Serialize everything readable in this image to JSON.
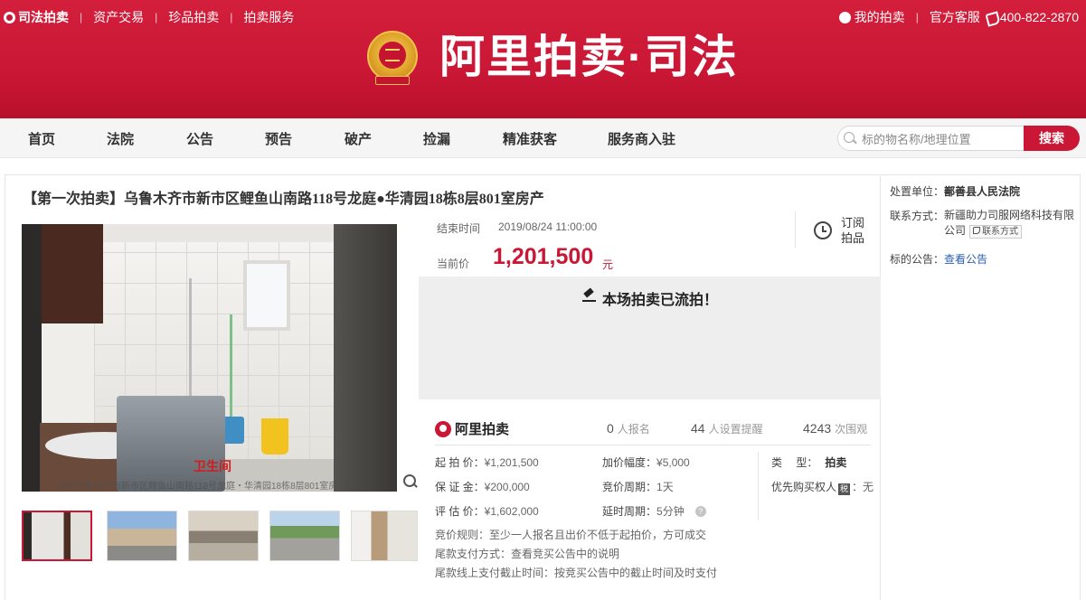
{
  "topbar": {
    "brand": "司法拍卖",
    "links": [
      "资产交易",
      "珍品拍卖",
      "拍卖服务"
    ],
    "my_auction": "我的拍卖",
    "service": "官方客服",
    "phone": "400-822-2870",
    "logo_text": "阿里拍卖·司法"
  },
  "nav": {
    "items": [
      "首页",
      "法院",
      "公告",
      "预告",
      "破产",
      "捡漏",
      "精准获客",
      "服务商入驻"
    ],
    "search_placeholder": "标的物名称/地理位置",
    "search_button": "搜索"
  },
  "item": {
    "title": "【第一次拍卖】乌鲁木齐市新市区鲤鱼山南路118号龙庭●华清园18栋8层801室房产",
    "photo_label": "卫生间",
    "photo_caption": "位于乌鲁木齐市新市区鲤鱼山南路118号龙庭・华清园18栋8层801室房产",
    "end_time_label": "结束时间",
    "end_time": "2019/08/24 11:00:00",
    "price_label": "当前价",
    "price": "1,201,500",
    "price_unit": "元",
    "subscribe": "订阅拍品",
    "status": "本场拍卖已流拍！",
    "platform": "阿里拍卖",
    "stats": {
      "registered_count": "0",
      "registered_label": "人报名",
      "reminder_count": "44",
      "reminder_label": "人设置提醒",
      "views_count": "4243",
      "views_label": "次围观"
    },
    "details": {
      "start_price_label": "起 拍 价：",
      "start_price": "¥1,201,500",
      "deposit_label": "保 证 金：",
      "deposit": "¥200,000",
      "appraisal_label": "评 估 价：",
      "appraisal": "¥1,602,000",
      "increment_label": "加价幅度：",
      "increment": "¥5,000",
      "cycle_label": "竞价周期：",
      "cycle": "1天",
      "extension_label": "延时周期：",
      "extension": "5分钟",
      "type_label": "类　 型：",
      "type": "拍卖",
      "priority_label": "优先购买权人",
      "priority_badge": "税",
      "priority_value": "：无",
      "rule": "竞价规则：至少一人报名且出价不低于起拍价，方可成交",
      "payment_method": "尾款支付方式：查看竞买公告中的说明",
      "payment_deadline": "尾款线上支付截止时间：按竞买公告中的截止时间及时支付"
    }
  },
  "sidebar": {
    "unit_label": "处置单位：",
    "unit": "鄯善县人民法院",
    "contact_label": "联系方式：",
    "contact": "新疆助力司服网络科技有限公司",
    "contact_button": "联系方式",
    "notice_label": "标的公告：",
    "notice_link": "查看公告"
  }
}
